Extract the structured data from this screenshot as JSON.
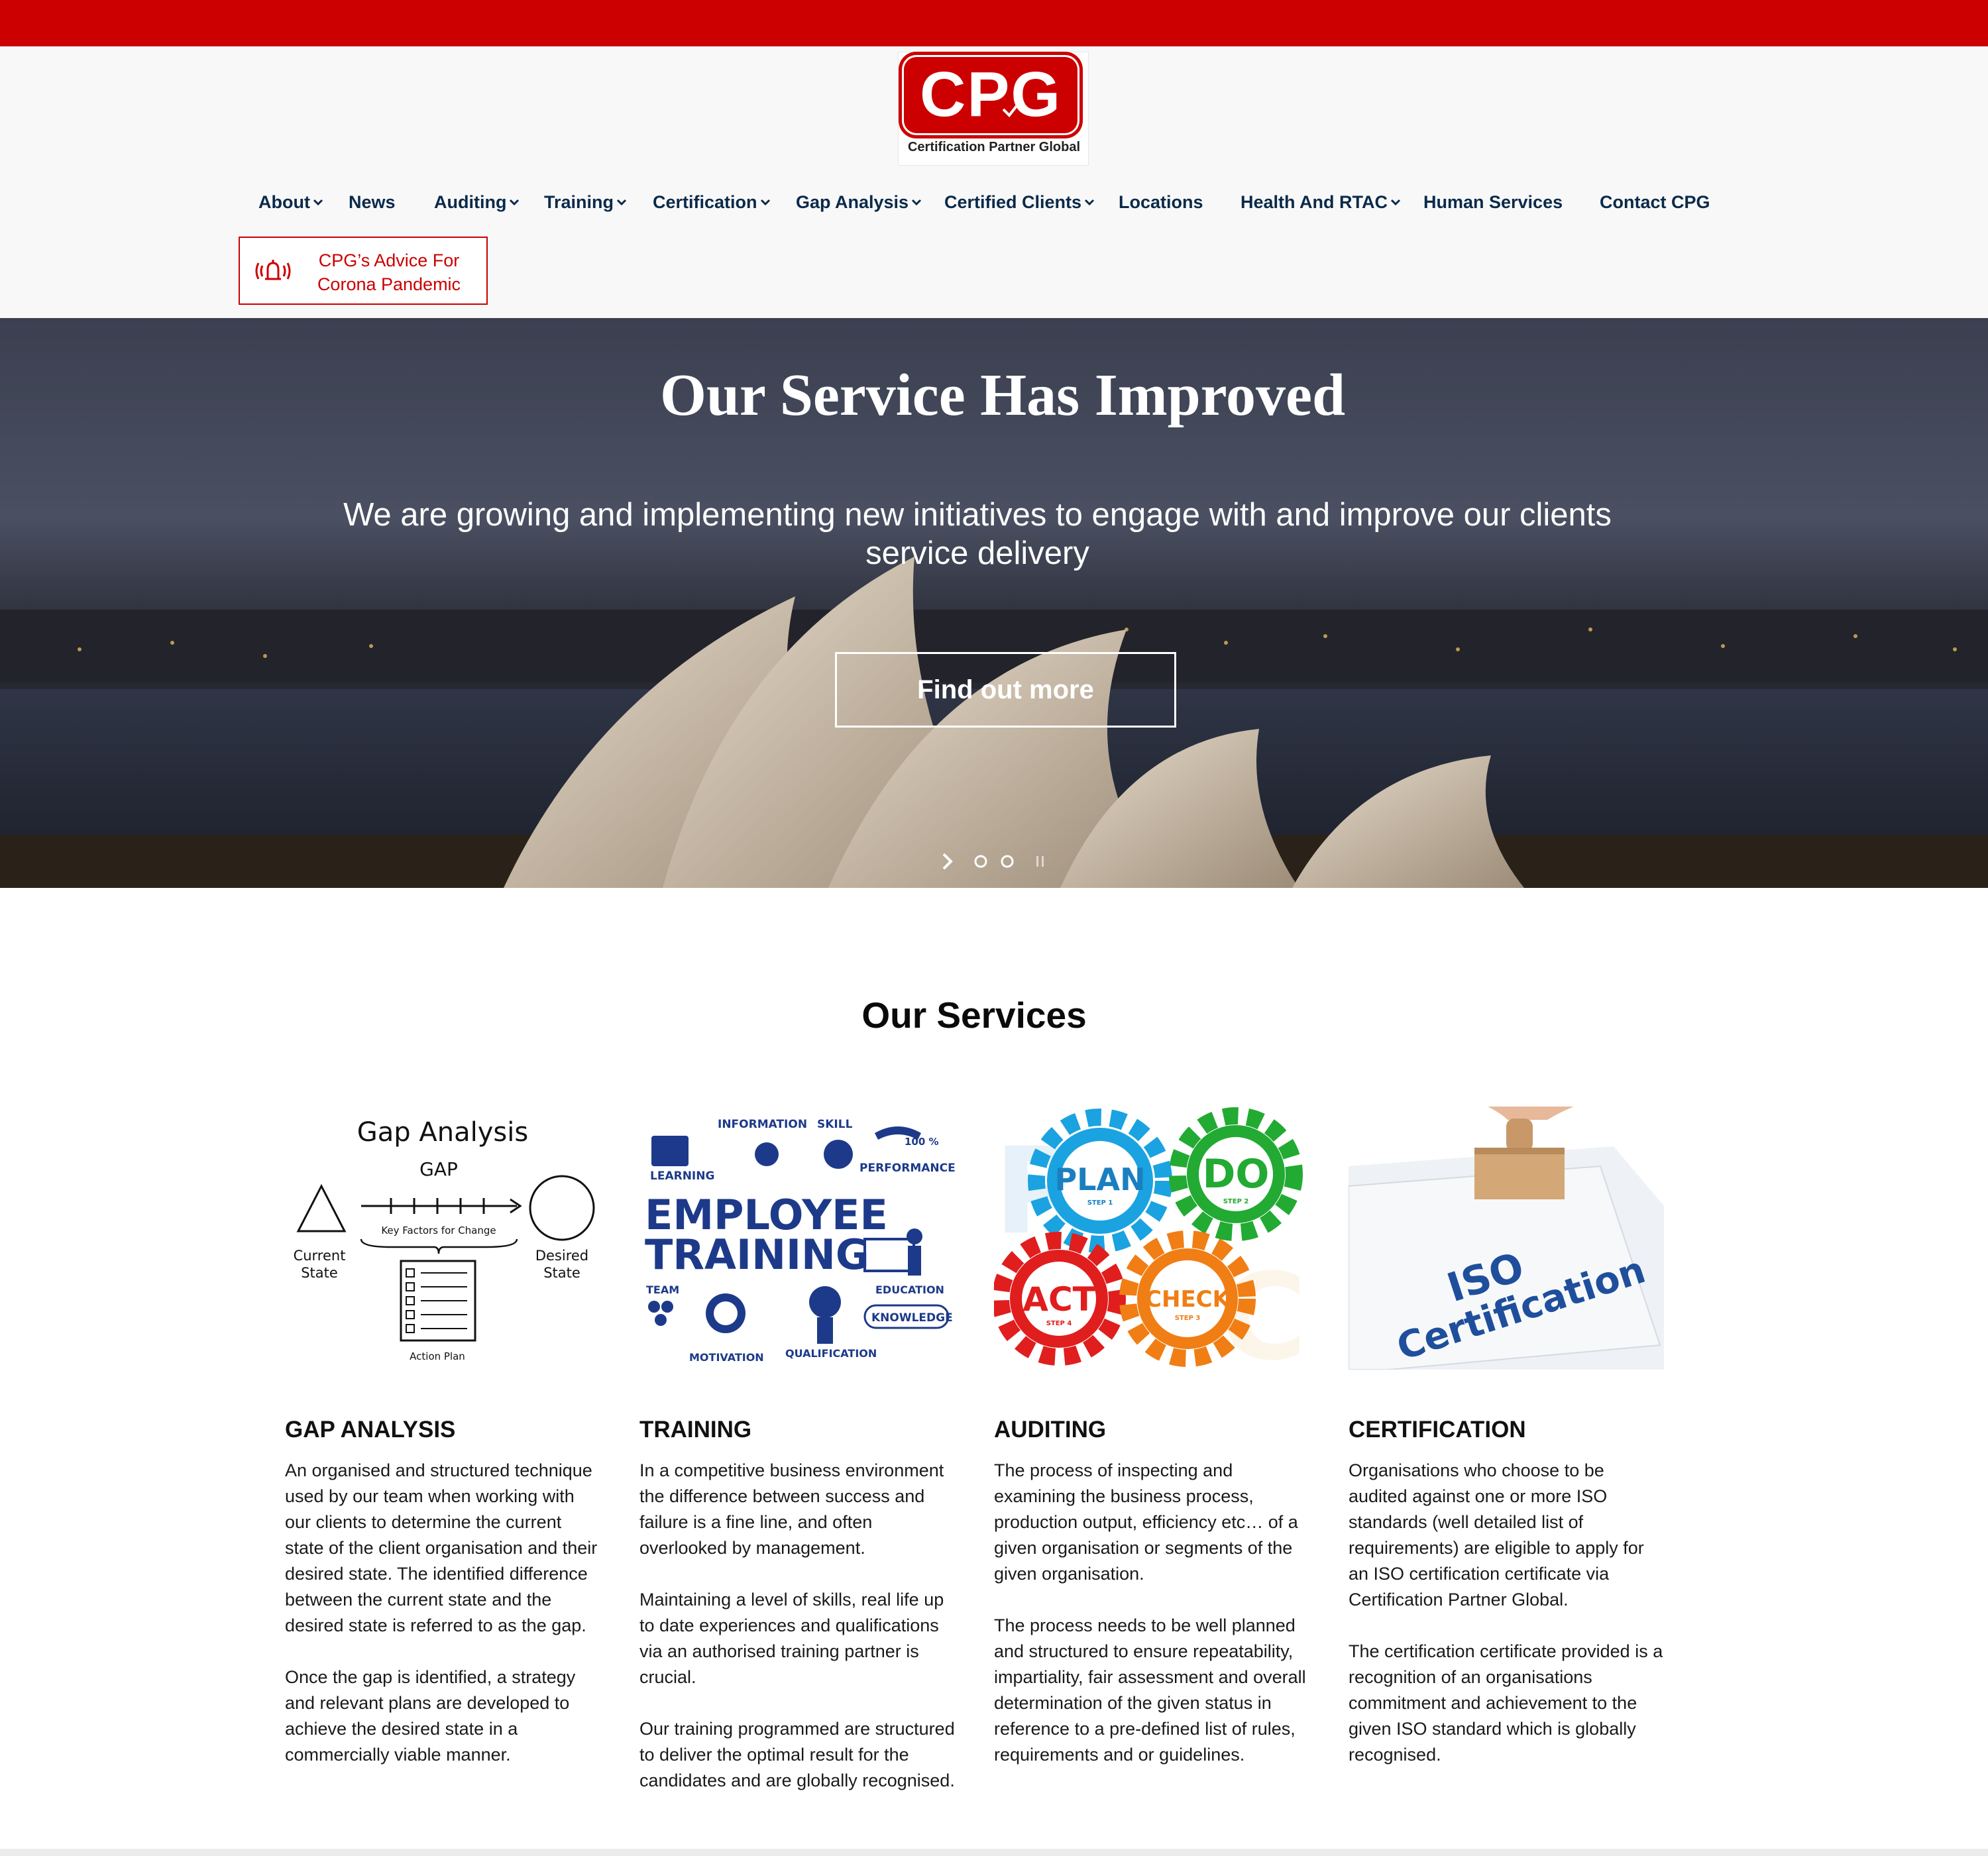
{
  "brand": {
    "logo_text": "CPG",
    "logo_subtitle": "Certification Partner Global",
    "red": "#cc0000",
    "navy": "#0b2a4a"
  },
  "nav": {
    "items": [
      {
        "label": "About",
        "dropdown": true
      },
      {
        "label": "News",
        "dropdown": false
      },
      {
        "label": "Auditing",
        "dropdown": true
      },
      {
        "label": "Training",
        "dropdown": true
      },
      {
        "label": "Certification",
        "dropdown": true
      },
      {
        "label": "Gap Analysis",
        "dropdown": true
      },
      {
        "label": "Certified Clients",
        "dropdown": true
      },
      {
        "label": "Locations",
        "dropdown": false
      },
      {
        "label": "Health And RTAC",
        "dropdown": true
      },
      {
        "label": "Human Services",
        "dropdown": false
      },
      {
        "label": "Contact CPG",
        "dropdown": false
      }
    ]
  },
  "alert": {
    "line1": "CPG’s Advice For",
    "line2": "Corona Pandemic",
    "icon": "alarm-bell-icon"
  },
  "hero": {
    "title": "Our Service Has Improved",
    "subtitle": "We are growing and implementing new initiatives to engage with and improve our clients service delivery",
    "button": "Find out more"
  },
  "services": {
    "title": "Our Services",
    "cards": [
      {
        "title": "GAP ANALYSIS",
        "paragraphs": [
          "An organised and structured technique used by our team when working with our clients to determine the current state of the client organisation and their desired state. The identified difference between the current state and the desired state is referred to as the gap.",
          "Once the gap is identified, a strategy and relevant plans are developed to achieve the desired state in a commercially viable manner."
        ],
        "image": {
          "heading": "Gap Analysis",
          "gap": "GAP",
          "key_factors": "Key Factors for Change",
          "current": [
            "Current",
            "State"
          ],
          "desired": [
            "Desired",
            "State"
          ],
          "action": "Action Plan"
        }
      },
      {
        "title": "TRAINING",
        "paragraphs": [
          "In a competitive business environment the difference between success and failure is a fine line, and often overlooked by management.",
          "Maintaining a level of skills, real life up to date experiences and qualifications via an authorised training partner is crucial.",
          "Our training programmed are structured to deliver the optimal result for the candidates and are globally recognised."
        ],
        "image": {
          "line1": "EMPLOYEE",
          "line2": "TRAINING",
          "words": [
            "INFORMATION",
            "SKILL",
            "100 %",
            "LEARNING",
            "PERFORMANCE",
            "TEAM",
            "EDUCATION",
            "KNOWLEDGE",
            "MOTIVATION",
            "QUALIFICATION"
          ]
        }
      },
      {
        "title": "AUDITING",
        "paragraphs": [
          "The process of inspecting and examining the business process, production output, efficiency etc… of a given organisation or segments of the given organisation.",
          "The process needs to be well planned and structured to ensure repeatability, impartiality, fair assessment and overall determination of the given status in reference to a pre-defined list of rules, requirements and or guidelines."
        ],
        "image": {
          "gears": [
            {
              "word": "PLAN",
              "step": "STEP 1",
              "color": "#1aa3e0"
            },
            {
              "word": "DO",
              "step": "STEP 2",
              "color": "#22aa33"
            },
            {
              "word": "ACT",
              "step": "STEP 4",
              "color": "#e01e1e"
            },
            {
              "word": "CHECK",
              "step": "STEP 3",
              "color": "#f07e14"
            }
          ]
        }
      },
      {
        "title": "CERTIFICATION",
        "paragraphs": [
          "Organisations who choose to be audited against one or more ISO standards (well detailed list of requirements) are eligible to apply for an ISO certification certificate via Certification Partner Global.",
          "The certification certificate provided is a recognition of an organisations commitment and achievement to the given ISO standard which is globally recognised."
        ],
        "image": {
          "line1": "ISO",
          "line2": "Certification"
        }
      }
    ]
  }
}
